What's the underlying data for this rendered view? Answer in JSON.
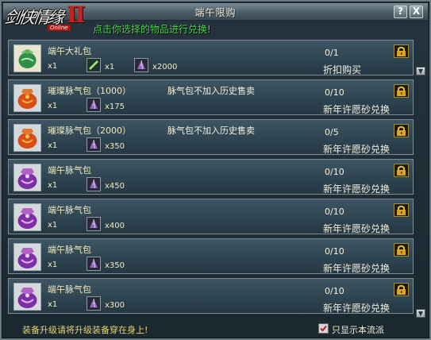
{
  "window": {
    "title": "端午限购",
    "help_label": "?",
    "close_label": "X",
    "scroll_down_label": "▼"
  },
  "logo": {
    "text": "剑侠情缘",
    "mark": "Ⅱ",
    "badge": "Online"
  },
  "notice": "点击你选择的物品进行兑换!",
  "items": [
    {
      "name": "端午大礼包",
      "note": "",
      "qty": "x1",
      "materials": [
        {
          "icon": "green-stick-icon",
          "count": "x1"
        },
        {
          "icon": "purple-sand-icon",
          "count": "x2000"
        }
      ],
      "count": "0/1",
      "action": "折扣购买",
      "icon": "green-gift-bag-icon"
    },
    {
      "name": "璀璨脉气包（1000）",
      "note": "脉气包不加入历史售卖",
      "qty": "x1",
      "materials": [
        {
          "icon": "purple-sand-icon",
          "count": "x175"
        }
      ],
      "count": "0/10",
      "action": "新年许愿砂兑换",
      "icon": "orange-pouch-icon"
    },
    {
      "name": "璀璨脉气包（2000）",
      "note": "脉气包不加入历史售卖",
      "qty": "x1",
      "materials": [
        {
          "icon": "purple-sand-icon",
          "count": "x350"
        }
      ],
      "count": "0/5",
      "action": "新年许愿砂兑换",
      "icon": "orange-pouch-icon"
    },
    {
      "name": "端午脉气包",
      "note": "",
      "qty": "x1",
      "materials": [
        {
          "icon": "purple-sand-icon",
          "count": "x450"
        }
      ],
      "count": "0/10",
      "action": "新年许愿砂兑换",
      "icon": "purple-pouch-icon"
    },
    {
      "name": "端午脉气包",
      "note": "",
      "qty": "x1",
      "materials": [
        {
          "icon": "purple-sand-icon",
          "count": "x400"
        }
      ],
      "count": "0/10",
      "action": "新年许愿砂兑换",
      "icon": "purple-pouch-icon"
    },
    {
      "name": "端午脉气包",
      "note": "",
      "qty": "x1",
      "materials": [
        {
          "icon": "purple-sand-icon",
          "count": "x350"
        }
      ],
      "count": "0/10",
      "action": "新年许愿砂兑换",
      "icon": "purple-pouch-icon"
    },
    {
      "name": "端午脉气包",
      "note": "",
      "qty": "x1",
      "materials": [
        {
          "icon": "purple-sand-icon",
          "count": "x300"
        }
      ],
      "count": "0/10",
      "action": "新年许愿砂兑换",
      "icon": "purple-pouch-icon"
    }
  ],
  "footer": {
    "tip": "装备升级请将升级装备穿在身上!",
    "filter_label": "只显示本流派",
    "filter_checked": true
  },
  "colors": {
    "notice": "#43db46",
    "item_name": "#f3e9bc",
    "footer_tip": "#e7d36a",
    "lock": "#d7a52a"
  }
}
